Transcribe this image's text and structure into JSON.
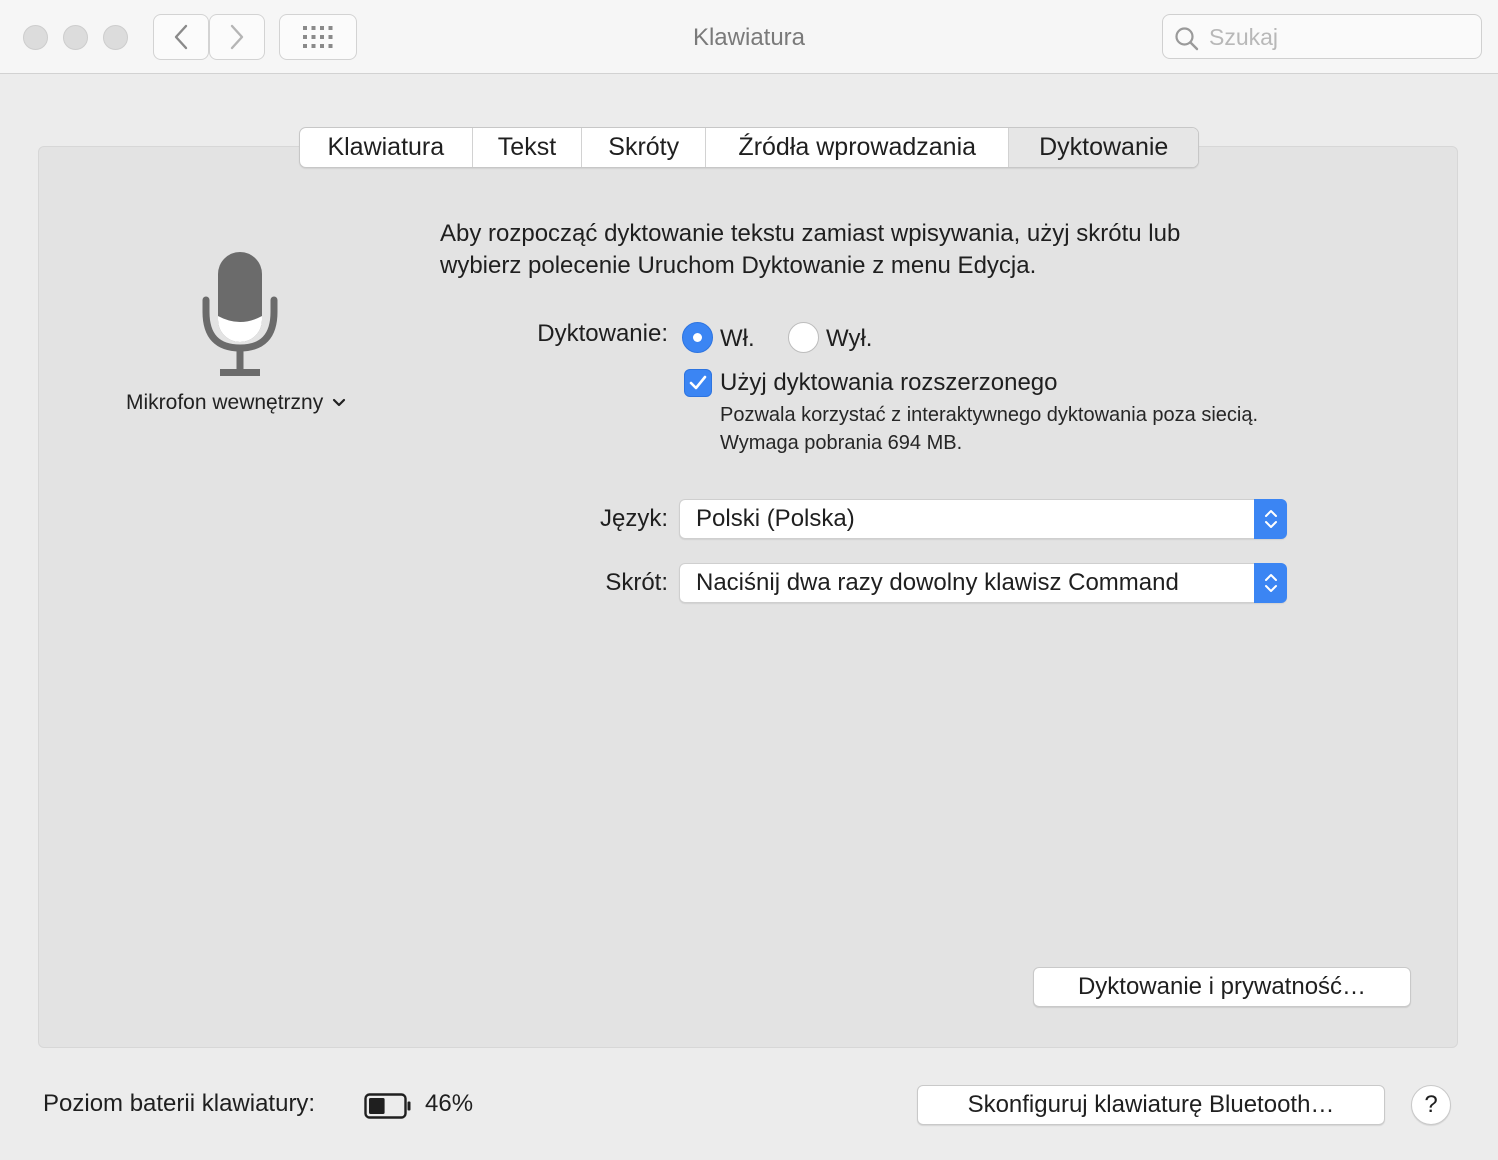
{
  "window": {
    "title": "Klawiatura"
  },
  "search": {
    "placeholder": "Szukaj"
  },
  "tabs": [
    {
      "label": "Klawiatura"
    },
    {
      "label": "Tekst"
    },
    {
      "label": "Skróty"
    },
    {
      "label": "Źródła wprowadzania"
    },
    {
      "label": "Dyktowanie",
      "active": true
    }
  ],
  "mic": {
    "source_label": "Mikrofon wewnętrzny",
    "icon": "microphone-icon"
  },
  "dictation": {
    "description_line1": "Aby rozpocząć dyktowanie tekstu zamiast wpisywania, użyj skrótu lub",
    "description_line2": "wybierz polecenie Uruchom Dyktowanie z menu Edycja.",
    "label": "Dyktowanie:",
    "on_label": "Wł.",
    "off_label": "Wył.",
    "selected": "on",
    "enhanced_label": "Użyj dyktowania rozszerzonego",
    "enhanced_checked": true,
    "enhanced_sub1": "Pozwala korzystać z interaktywnego dyktowania poza siecią.",
    "enhanced_sub2": "Wymaga pobrania 694 MB."
  },
  "language": {
    "label": "Język:",
    "value": "Polski (Polska)"
  },
  "shortcut": {
    "label": "Skrót:",
    "value": "Naciśnij dwa razy dowolny klawisz Command"
  },
  "buttons": {
    "privacy": "Dyktowanie i prywatność…",
    "bluetooth": "Skonfiguruj klawiaturę Bluetooth…",
    "help": "?"
  },
  "battery": {
    "label": "Poziom baterii klawiatury:",
    "percent_text": "46%",
    "level": 0.46
  },
  "colors": {
    "accent": "#3b85f3",
    "window_bg": "#ececec",
    "panel_bg": "#e3e3e3"
  }
}
